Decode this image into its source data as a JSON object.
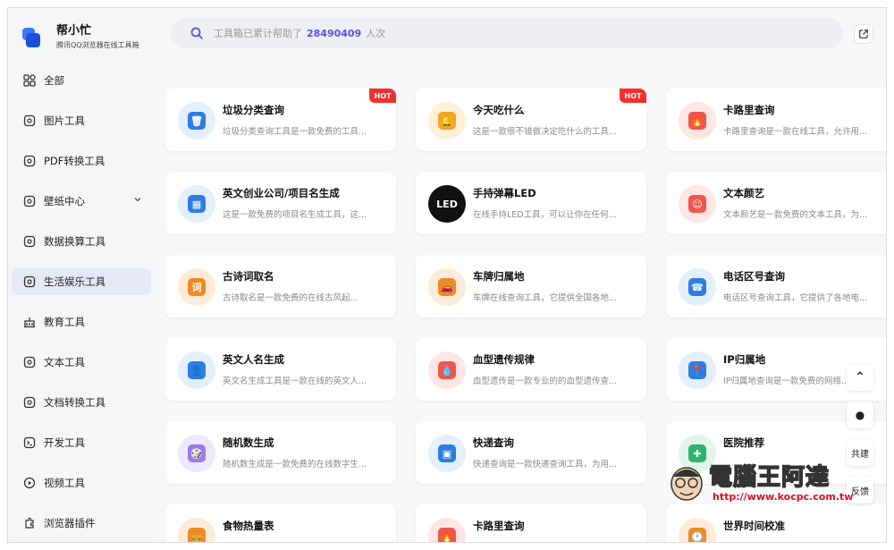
{
  "brand": {
    "name": "帮小忙",
    "subtitle": "腾讯QQ浏览器在线工具箱"
  },
  "sidebar": {
    "items": [
      {
        "label": "全部",
        "icon": "grid-icon"
      },
      {
        "label": "图片工具",
        "icon": "image-icon"
      },
      {
        "label": "PDF转换工具",
        "icon": "pdf-icon"
      },
      {
        "label": "壁纸中心",
        "icon": "wallpaper-icon",
        "has_chevron": true
      },
      {
        "label": "数据换算工具",
        "icon": "chart-icon"
      },
      {
        "label": "生活娱乐工具",
        "icon": "life-icon",
        "active": true
      },
      {
        "label": "教育工具",
        "icon": "school-icon"
      },
      {
        "label": "文本工具",
        "icon": "text-icon"
      },
      {
        "label": "文档转换工具",
        "icon": "document-icon"
      },
      {
        "label": "开发工具",
        "icon": "terminal-icon"
      },
      {
        "label": "视频工具",
        "icon": "video-icon"
      },
      {
        "label": "浏览器插件",
        "icon": "plugin-icon"
      }
    ]
  },
  "search": {
    "prefix": "工具箱已累计帮助了",
    "count": "28490409",
    "suffix": "人次"
  },
  "hot_label": "HOT",
  "cards": [
    {
      "title": "垃圾分类查询",
      "desc": "垃圾分类查询工具是一款免费的工具...",
      "hot": true,
      "color": "#2f7de1",
      "bg": "#e3effc",
      "glyph": "🗑"
    },
    {
      "title": "今天吃什么",
      "desc": "这是一款很不错做决定吃什么的工具...",
      "hot": true,
      "color": "#f5a623",
      "bg": "#fdf1d9",
      "glyph": "🔔"
    },
    {
      "title": "卡路里查询",
      "desc": "卡路里查询是一款在线工具，允许用...",
      "hot": false,
      "color": "#f0564a",
      "bg": "#fde6e4",
      "glyph": "🔥"
    },
    {
      "title": "英文创业公司/项目名生成",
      "desc": "这是一款免费的项目名生成工具，这...",
      "hot": false,
      "color": "#2f7de1",
      "bg": "#e3effc",
      "glyph": "▦"
    },
    {
      "title": "手持弹幕LED",
      "desc": "在线手持LED工具，可以让你在任何...",
      "hot": false,
      "color": "#111111",
      "bg": "#111111",
      "glyph": "LED"
    },
    {
      "title": "文本颜艺",
      "desc": "文本颜艺是一款免费的文本工具，为...",
      "hot": false,
      "color": "#f0564a",
      "bg": "#fde6e4",
      "glyph": "☺"
    },
    {
      "title": "古诗词取名",
      "desc": "古诗取名是一款免费的在线古风起...",
      "hot": false,
      "color": "#f08a24",
      "bg": "#fdebd9",
      "glyph": "词"
    },
    {
      "title": "车牌归属地",
      "desc": "车牌在线查询工具，它提供全国各地...",
      "hot": false,
      "color": "#f08a24",
      "bg": "#fdebd9",
      "glyph": "🚗"
    },
    {
      "title": "电话区号查询",
      "desc": "电话区号查询工具，它提供了各地电...",
      "hot": false,
      "color": "#2f7de1",
      "bg": "#e3effc",
      "glyph": "☎"
    },
    {
      "title": "英文人名生成",
      "desc": "英文名生成工具是一款在线的英文人...",
      "hot": false,
      "color": "#2f7de1",
      "bg": "#e3effc",
      "glyph": "👤"
    },
    {
      "title": "血型遗传规律",
      "desc": "血型遗传是一款专业的的血型遗传查...",
      "hot": false,
      "color": "#f0564a",
      "bg": "#fde6e4",
      "glyph": "💧"
    },
    {
      "title": "IP归属地",
      "desc": "IP归属地查询是一款免费的网络...",
      "hot": false,
      "color": "#2f7de1",
      "bg": "#e3effc",
      "glyph": "📍"
    },
    {
      "title": "随机数生成",
      "desc": "随机数生成是一款免费的在线数字生...",
      "hot": false,
      "color": "#9b7be8",
      "bg": "#eee8fb",
      "glyph": "🎲"
    },
    {
      "title": "快递查询",
      "desc": "快递查询是一款快递查询工具，为用...",
      "hot": false,
      "color": "#2f7de1",
      "bg": "#e3effc",
      "glyph": "▣"
    },
    {
      "title": "医院推荐",
      "desc": "",
      "hot": false,
      "color": "#2fb36a",
      "bg": "#e2f5ea",
      "glyph": "✚"
    },
    {
      "title": "食物热量表",
      "desc": "",
      "hot": false,
      "color": "#f08a24",
      "bg": "#fdebd9",
      "glyph": "🍔"
    },
    {
      "title": "卡路里查询",
      "desc": "",
      "hot": false,
      "color": "#f0564a",
      "bg": "#fde6e4",
      "glyph": "🔥"
    },
    {
      "title": "世界时间校准",
      "desc": "",
      "hot": false,
      "color": "#f08a24",
      "bg": "#fdebd9",
      "glyph": "🕐"
    }
  ],
  "floats": {
    "top": "⌃",
    "qq": "●",
    "share": "共建",
    "feedback": "反馈"
  },
  "watermark": {
    "text": "電腦王阿達",
    "url": "http://www.kocpc.com.tw"
  }
}
